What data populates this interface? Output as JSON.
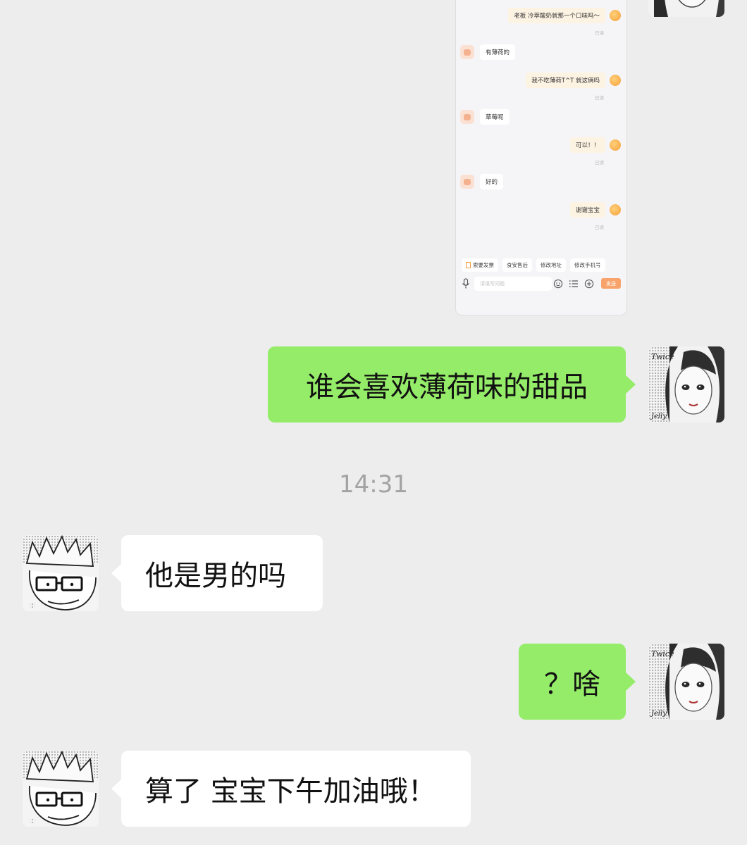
{
  "screenshot": {
    "messages": [
      {
        "side": "out",
        "text": "老板 冷萃酸奶就那一个口味吗～",
        "status": "已读"
      },
      {
        "side": "in",
        "text": "有薄荷的"
      },
      {
        "side": "out",
        "text": "我不吃薄荷T^T 就这俩吗",
        "status": "已读"
      },
      {
        "side": "in",
        "text": "草莓呢"
      },
      {
        "side": "out",
        "text": "可以！！",
        "status": "已读"
      },
      {
        "side": "in",
        "text": "好的"
      },
      {
        "side": "out",
        "text": "谢谢宝宝",
        "status": "已读"
      }
    ],
    "quick_actions": [
      "索要发票",
      "食安售后",
      "修改地址",
      "修改手机号"
    ],
    "input_placeholder": "请填写问题",
    "send_label": "发送",
    "icons": [
      "microphone-icon",
      "emoji-icon",
      "list-icon",
      "plus-icon"
    ]
  },
  "chat": {
    "msg1": "谁会喜欢薄荷味的甜品",
    "timestamp": "14:31",
    "msg2": "他是男的吗",
    "msg3": "？啥",
    "msg4": "算了 宝宝下午加油哦！"
  },
  "colors": {
    "background": "#ededed",
    "outgoing_bubble": "#95ec69",
    "incoming_bubble": "#ffffff"
  }
}
